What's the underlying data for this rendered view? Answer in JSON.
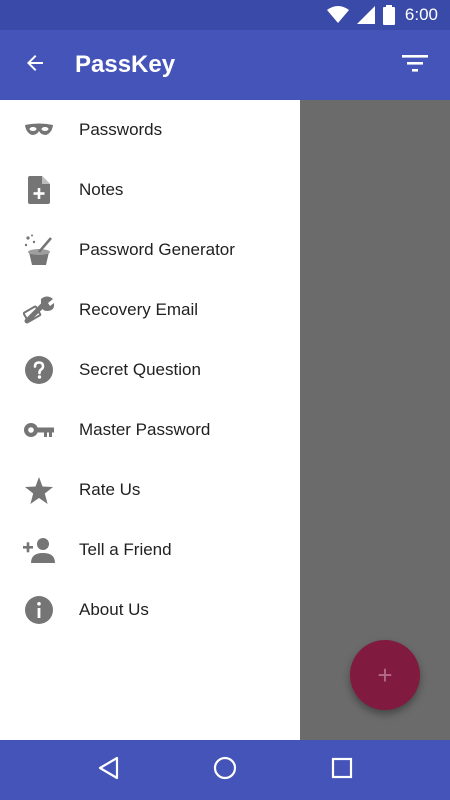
{
  "status_bar": {
    "time": "6:00",
    "icons": [
      "wifi-icon",
      "signal-icon",
      "battery-icon"
    ]
  },
  "app_bar": {
    "title": "PassKey",
    "back_icon": "arrow-back-icon",
    "filter_icon": "filter-icon"
  },
  "drawer": {
    "items": [
      {
        "label": "Passwords",
        "icon": "mask-icon"
      },
      {
        "label": "Notes",
        "icon": "note-add-icon"
      },
      {
        "label": "Password Generator",
        "icon": "magic-hat-icon"
      },
      {
        "label": "Recovery Email",
        "icon": "wrench-icon"
      },
      {
        "label": "Secret Question",
        "icon": "help-icon"
      },
      {
        "label": "Master Password",
        "icon": "key-icon"
      },
      {
        "label": "Rate Us",
        "icon": "star-icon"
      },
      {
        "label": "Tell a Friend",
        "icon": "person-add-icon"
      },
      {
        "label": "About Us",
        "icon": "info-icon"
      }
    ]
  },
  "fab": {
    "symbol": "+"
  },
  "colors": {
    "primary": "#4554b8",
    "primary_dark": "#3a4aa8",
    "accent": "#801a3f",
    "icon_gray": "#757575"
  }
}
